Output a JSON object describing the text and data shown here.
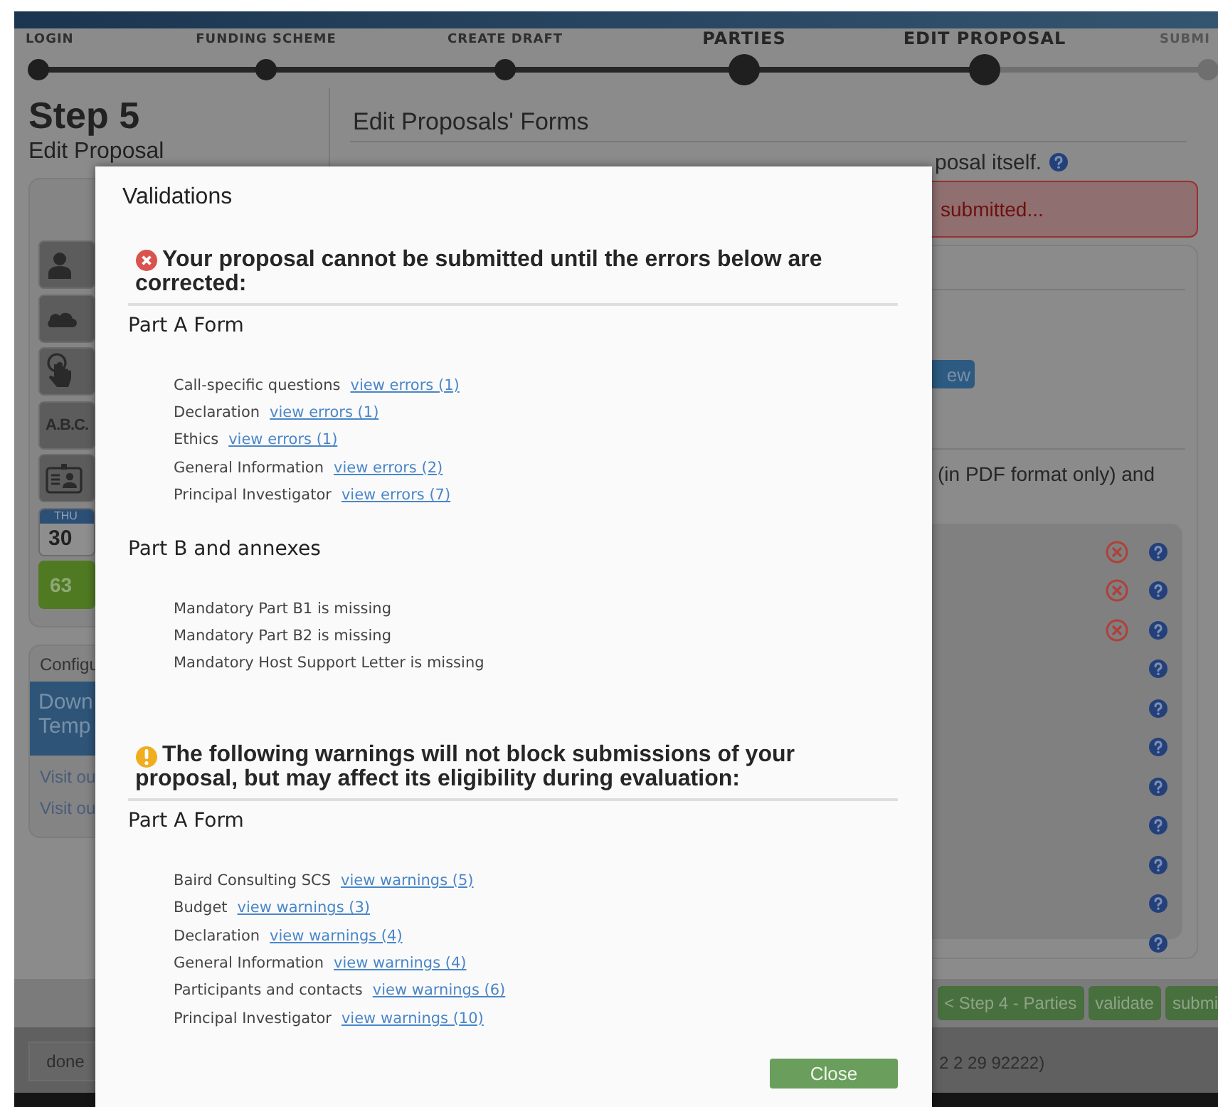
{
  "stepper": [
    {
      "label": "LOGIN",
      "major": false,
      "reached": true
    },
    {
      "label": "FUNDING SCHEME",
      "major": false,
      "reached": true
    },
    {
      "label": "CREATE DRAFT",
      "major": false,
      "reached": true
    },
    {
      "label": "PARTIES",
      "major": true,
      "reached": true
    },
    {
      "label": "EDIT PROPOSAL",
      "major": true,
      "reached": true
    },
    {
      "label": "SUBMI",
      "major": false,
      "reached": false
    }
  ],
  "sidebar": {
    "step_title": "Step 5",
    "step_subtitle": "Edit Proposal",
    "tiles": [
      {
        "kind": "person"
      },
      {
        "kind": "cloud"
      },
      {
        "kind": "touch"
      },
      {
        "kind": "text",
        "text": "A.B.C."
      },
      {
        "kind": "badge"
      },
      {
        "kind": "calendar",
        "day": "THU",
        "date": "30"
      },
      {
        "kind": "count",
        "text": "63"
      }
    ],
    "config_title": "Configu",
    "download_lines": [
      "Down",
      "Temp"
    ],
    "links": [
      "Visit ou",
      "Visit ou"
    ]
  },
  "main": {
    "title": "Edit Proposals' Forms",
    "intro_fragment": "posal itself.",
    "alert_fragment": "submitted...",
    "button_fragment": "ew",
    "pdf_fragment": "(in PDF format only) and",
    "document_rows": [
      {
        "error": true
      },
      {
        "error": true
      },
      {
        "error": true
      },
      {
        "error": false
      },
      {
        "error": false
      },
      {
        "error": false
      },
      {
        "error": false
      },
      {
        "error": false
      },
      {
        "error": false
      },
      {
        "error": false
      },
      {
        "error": false
      }
    ]
  },
  "bottom_bar": {
    "buttons": [
      "< Step 4 - Parties",
      "validate",
      "submi"
    ]
  },
  "footer": {
    "done_button": "done",
    "contact_fragment": "2 2 29 92222)"
  },
  "dialog": {
    "title": "Validations",
    "groups": [
      {
        "kind": "error",
        "heading": "Your proposal cannot be submitted until the errors below are corrected:",
        "sections": [
          {
            "title": "Part A Form",
            "items": [
              {
                "label": "Call-specific questions",
                "link": "view errors (1)"
              },
              {
                "label": "Declaration",
                "link": "view errors (1)"
              },
              {
                "label": "Ethics",
                "link": "view errors (1)"
              },
              {
                "label": "General Information",
                "link": "view errors (2)"
              },
              {
                "label": "Principal Investigator",
                "link": "view errors (7)"
              }
            ]
          },
          {
            "title": "Part B and annexes",
            "items": [
              {
                "label": "Mandatory Part B1 is missing"
              },
              {
                "label": "Mandatory Part B2 is missing"
              },
              {
                "label": "Mandatory Host Support Letter is missing"
              }
            ]
          }
        ]
      },
      {
        "kind": "warning",
        "heading": "The following warnings will not block submissions of your proposal, but may affect its eligibility during evaluation:",
        "sections": [
          {
            "title": "Part A Form",
            "items": [
              {
                "label": "Baird Consulting SCS",
                "link": "view warnings (5)"
              },
              {
                "label": "Budget",
                "link": "view warnings (3)"
              },
              {
                "label": "Declaration",
                "link": "view warnings (4)"
              },
              {
                "label": "General Information",
                "link": "view warnings (4)"
              },
              {
                "label": "Participants and contacts",
                "link": "view warnings (6)"
              },
              {
                "label": "Principal Investigator",
                "link": "view warnings (10)"
              }
            ]
          }
        ]
      }
    ],
    "close_button": "Close"
  }
}
